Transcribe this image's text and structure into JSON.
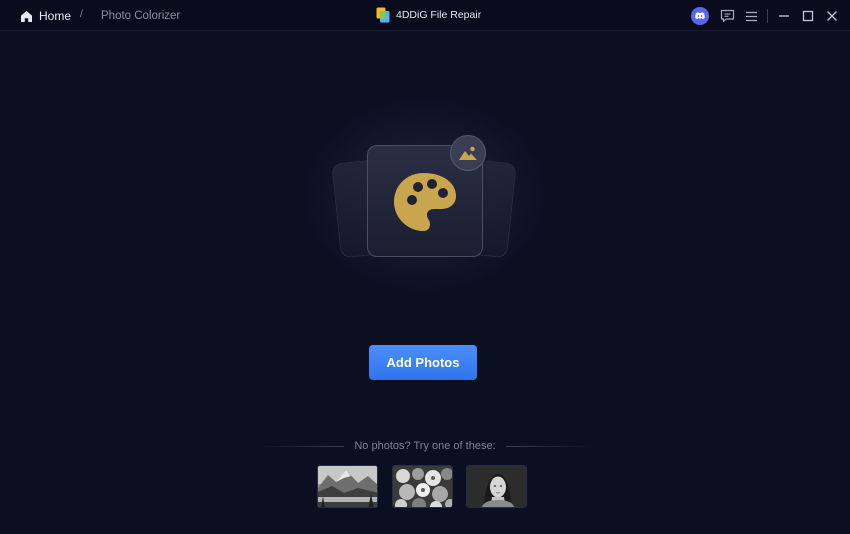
{
  "titlebar": {
    "home_label": "Home",
    "separator": "/",
    "current_page": "Photo Colorizer",
    "app_title": "4DDiG File Repair"
  },
  "main": {
    "add_button_label": "Add Photos",
    "samples_label": "No photos? Try one of these:"
  },
  "samples": [
    {
      "name": "landscape-sample"
    },
    {
      "name": "flowers-sample"
    },
    {
      "name": "portrait-sample"
    }
  ],
  "colors": {
    "background": "#0c0e22",
    "accent": "#3a7cf2",
    "palette_gold": "#c9a54d",
    "discord": "#5865f2"
  },
  "icons": [
    "home-icon",
    "app-logo-icon",
    "discord-icon",
    "feedback-icon",
    "menu-icon",
    "minimize-icon",
    "maximize-icon",
    "close-icon",
    "palette-icon",
    "image-badge-icon"
  ]
}
